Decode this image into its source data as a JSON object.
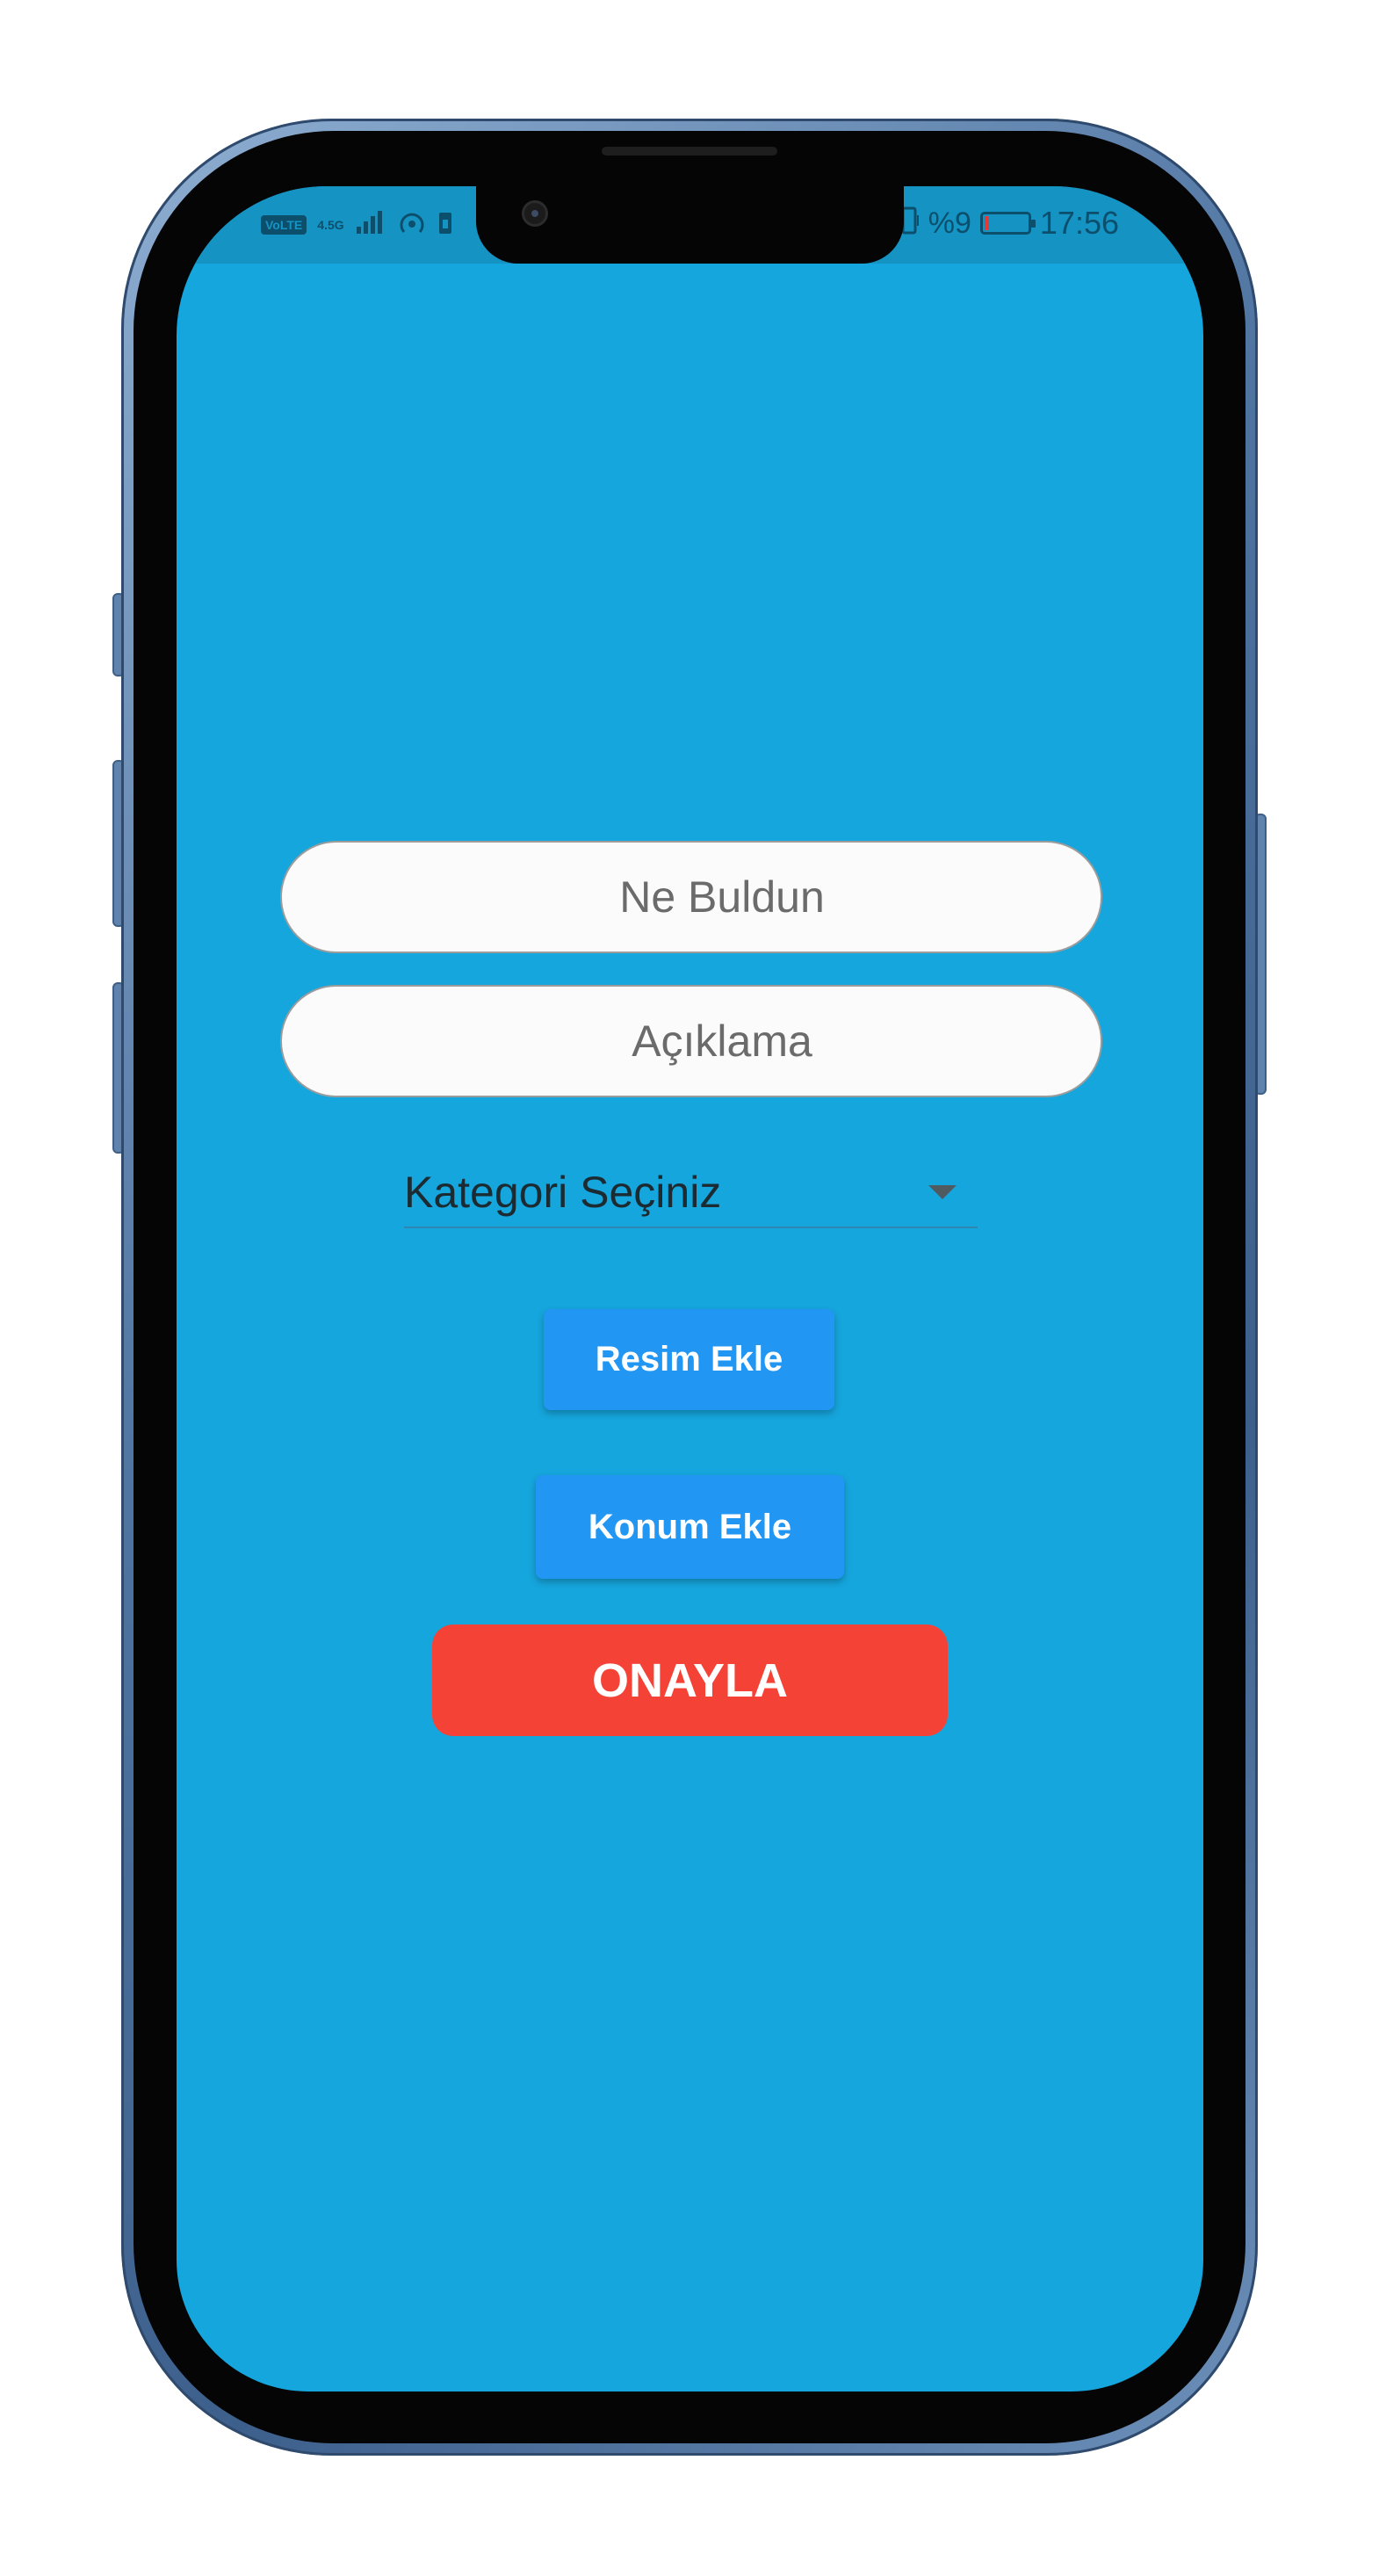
{
  "status_bar": {
    "volte": "VoLTE",
    "network": "4.5G",
    "battery_percent": "%9",
    "battery_level": 0.09,
    "time": "17:56",
    "icons": [
      "signal-icon",
      "hotspot-icon",
      "sim-icon",
      "battery-icon"
    ]
  },
  "form": {
    "what_found_placeholder": "Ne Buldun",
    "description_placeholder": "Açıklama",
    "category_dropdown_value": "Kategori Seçiniz",
    "add_image_label": "Resim Ekle",
    "add_location_label": "Konum Ekle",
    "confirm_label": "ONAYLA"
  },
  "colors": {
    "background": "#15a6dd",
    "status_bar": "#1593c3",
    "action_button": "#2196f3",
    "confirm_button": "#f44336",
    "phone_frame": "#4f74a1"
  }
}
